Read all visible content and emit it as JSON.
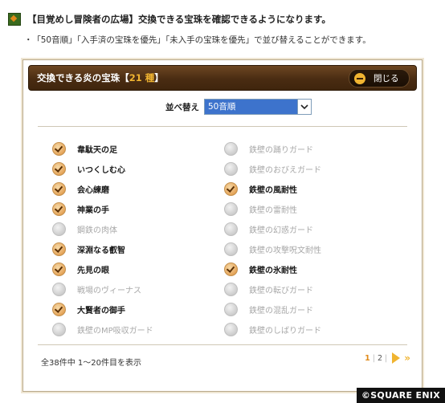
{
  "header": {
    "title": "【目覚めし冒険者の広場】交換できる宝珠を確認できるようになります。"
  },
  "note": {
    "bullet": "・",
    "text": "「50音順」「入手済の宝珠を優先」「未入手の宝珠を優先」で並び替えることができます。"
  },
  "panel": {
    "title_prefix": "交換できる炎の宝珠【",
    "title_count": "21 種",
    "title_suffix": "】",
    "close_label": "閉じる"
  },
  "sort": {
    "label": "並べ替え",
    "selected": "50音順"
  },
  "items_left": [
    {
      "label": "韋駄天の足",
      "owned": true
    },
    {
      "label": "いつくしむ心",
      "owned": true
    },
    {
      "label": "会心練磨",
      "owned": true
    },
    {
      "label": "神業の手",
      "owned": true
    },
    {
      "label": "鋼鉄の肉体",
      "owned": false
    },
    {
      "label": "深淵なる叡智",
      "owned": true
    },
    {
      "label": "先見の眼",
      "owned": true
    },
    {
      "label": "戦場のヴィーナス",
      "owned": false
    },
    {
      "label": "大賢者の御手",
      "owned": true
    },
    {
      "label": "鉄壁のMP吸収ガード",
      "owned": false
    }
  ],
  "items_right": [
    {
      "label": "鉄壁の踊りガード",
      "owned": false
    },
    {
      "label": "鉄壁のおびえガード",
      "owned": false
    },
    {
      "label": "鉄壁の風耐性",
      "owned": true
    },
    {
      "label": "鉄壁の雷耐性",
      "owned": false
    },
    {
      "label": "鉄壁の幻惑ガード",
      "owned": false
    },
    {
      "label": "鉄壁の攻撃呪文耐性",
      "owned": false
    },
    {
      "label": "鉄壁の氷耐性",
      "owned": true
    },
    {
      "label": "鉄壁の転びガード",
      "owned": false
    },
    {
      "label": "鉄壁の混乱ガード",
      "owned": false
    },
    {
      "label": "鉄壁のしばりガード",
      "owned": false
    }
  ],
  "footer": {
    "summary": "全38件中 1～20件目を表示",
    "pages": [
      "1",
      "2"
    ],
    "current_page": "1"
  },
  "copyright": "©SQUARE ENIX",
  "colors": {
    "titlebar": "#4a2c12",
    "accent": "#f0b431",
    "select_highlight": "#3d73cc"
  }
}
